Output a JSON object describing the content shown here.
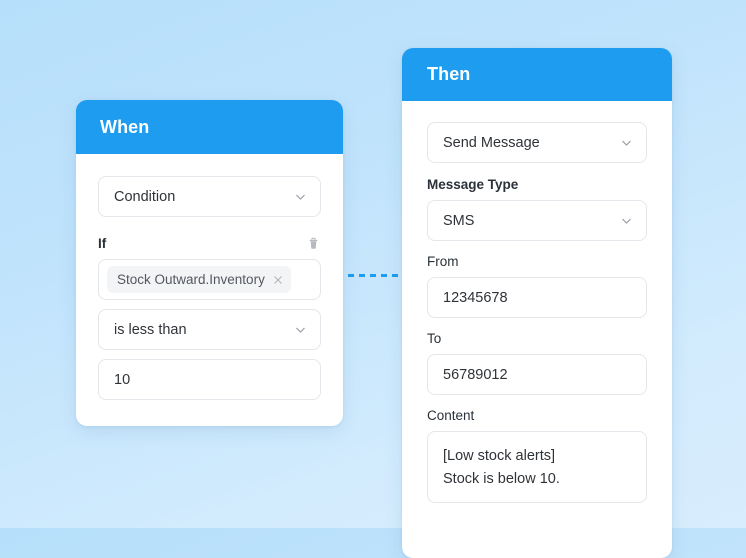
{
  "background": {
    "gradient_from": "#b6dffb",
    "gradient_to": "#d8edfd"
  },
  "accent_color": "#1e9cf0",
  "connector": {
    "style": "dashed",
    "color": "#1e9cf0"
  },
  "when_card": {
    "header_title": "When",
    "trigger_select": {
      "value": "Condition",
      "chevron": "chevron-down-icon"
    },
    "if_label": "If",
    "delete_icon": "trash-icon",
    "field_token": {
      "label": "Stock Outward.Inventory",
      "remove_icon": "close-icon"
    },
    "operator_select": {
      "value": "is less than",
      "chevron": "chevron-down-icon"
    },
    "value_input": {
      "value": "10"
    }
  },
  "then_card": {
    "header_title": "Then",
    "action_select": {
      "value": "Send Message",
      "chevron": "chevron-down-icon"
    },
    "message_type": {
      "label": "Message Type",
      "value": "SMS",
      "chevron": "chevron-down-icon"
    },
    "from": {
      "label": "From",
      "value": "12345678"
    },
    "to": {
      "label": "To",
      "value": "56789012"
    },
    "content": {
      "label": "Content",
      "line1": "[Low stock alerts]",
      "line2": "Stock is below 10."
    }
  }
}
